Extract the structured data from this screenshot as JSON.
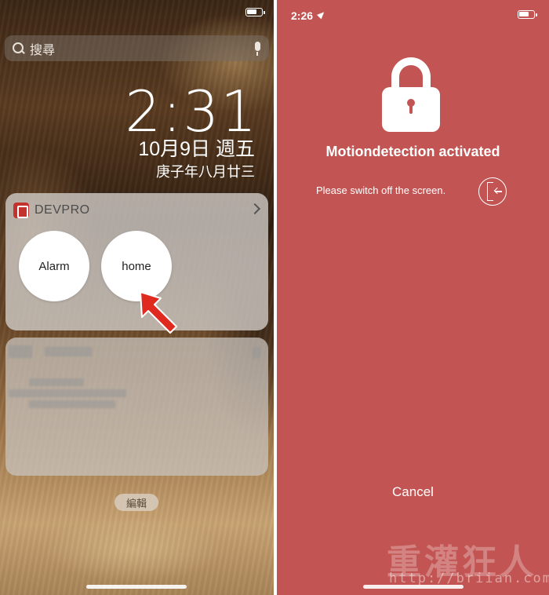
{
  "left_screen": {
    "search": {
      "placeholder": "搜尋"
    },
    "clock": {
      "time": "2:31",
      "date": "10月9日 週五",
      "lunar_date": "庚子年八月廿三"
    },
    "widget": {
      "app_name": "DEVPRO",
      "buttons": [
        {
          "label": "Alarm"
        },
        {
          "label": "home"
        }
      ]
    },
    "edit_button": "編輯"
  },
  "right_screen": {
    "status_time": "2:26",
    "title": "Motiondetection activated",
    "message": "Please switch off the screen.",
    "cancel_label": "Cancel",
    "background_color": "#c25553",
    "icons": [
      "lock-icon",
      "screen-off-icon",
      "location-arrow-icon",
      "battery-icon"
    ],
    "watermark": {
      "title": "重灌狂人",
      "url": "http://briian.com"
    }
  }
}
